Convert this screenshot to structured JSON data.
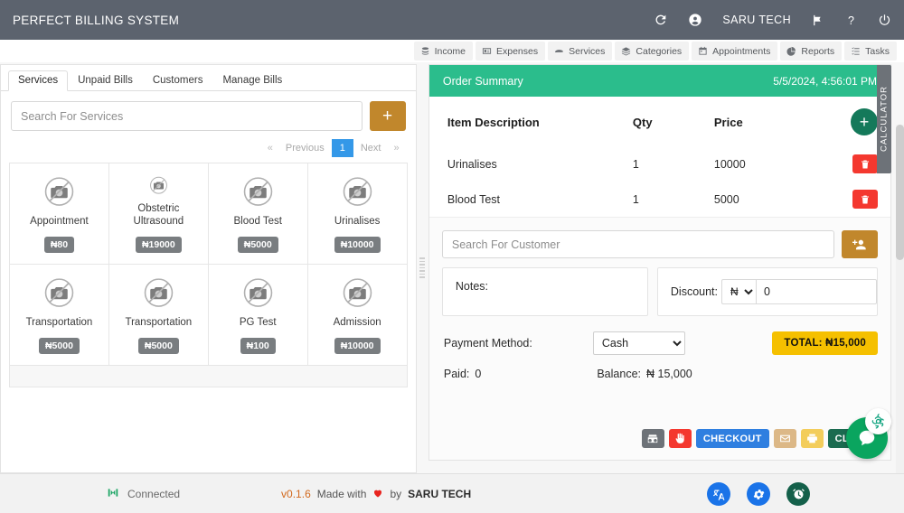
{
  "header": {
    "app_title": "PERFECT BILLING SYSTEM",
    "org_name": "SARU TECH",
    "icons": [
      "refresh-icon",
      "account-icon",
      "flag-icon",
      "help-icon",
      "power-icon"
    ]
  },
  "nav_tabs": [
    {
      "label": "Income",
      "icon": "coins-icon"
    },
    {
      "label": "Expenses",
      "icon": "receipt-icon"
    },
    {
      "label": "Services",
      "icon": "services-icon"
    },
    {
      "label": "Categories",
      "icon": "layers-icon"
    },
    {
      "label": "Appointments",
      "icon": "calendar-icon"
    },
    {
      "label": "Reports",
      "icon": "pie-chart-icon"
    },
    {
      "label": "Tasks",
      "icon": "list-icon"
    }
  ],
  "left_panel": {
    "tabs": [
      {
        "label": "Services",
        "active": true
      },
      {
        "label": "Unpaid Bills",
        "active": false
      },
      {
        "label": "Customers",
        "active": false
      },
      {
        "label": "Manage Bills",
        "active": false
      }
    ],
    "search": {
      "placeholder": "Search For Services",
      "value": ""
    },
    "add_button_label": "+",
    "pagination": {
      "first": "«",
      "previous": "Previous",
      "current_page": "1",
      "next": "Next",
      "last": "»"
    },
    "services": [
      {
        "name": "Appointment",
        "price": "₦80"
      },
      {
        "name": "Obstetric Ultrasound",
        "price": "₦19000"
      },
      {
        "name": "Blood Test",
        "price": "₦5000"
      },
      {
        "name": "Urinalises",
        "price": "₦10000"
      },
      {
        "name": "Transportation",
        "price": "₦5000"
      },
      {
        "name": "Transportation",
        "price": "₦5000"
      },
      {
        "name": "PG Test",
        "price": "₦100"
      },
      {
        "name": "Admission",
        "price": "₦10000"
      }
    ]
  },
  "order_summary": {
    "title": "Order Summary",
    "datetime": "5/5/2024, 4:56:01 PM",
    "columns": {
      "description": "Item Description",
      "qty": "Qty",
      "price": "Price"
    },
    "add_item_label": "+",
    "items": [
      {
        "description": "Urinalises",
        "qty": "1",
        "price": "10000"
      },
      {
        "description": "Blood Test",
        "qty": "1",
        "price": "5000"
      }
    ],
    "customer_search": {
      "placeholder": "Search For Customer",
      "value": ""
    },
    "notes_label": "Notes:",
    "discount": {
      "label": "Discount:",
      "currency": "₦",
      "value": "0"
    },
    "payment": {
      "label": "Payment Method:",
      "selected": "Cash"
    },
    "total_label": "TOTAL: ₦15,000",
    "paid_label": "Paid:",
    "paid_value": "0",
    "balance_label": "Balance:",
    "balance_value": "₦ 15,000",
    "actions": [
      {
        "name": "register",
        "label": ""
      },
      {
        "name": "hold",
        "label": ""
      },
      {
        "name": "checkout",
        "label": "CHECKOUT"
      },
      {
        "name": "email",
        "label": ""
      },
      {
        "name": "print",
        "label": ""
      },
      {
        "name": "clear",
        "label": "CLEAR"
      }
    ],
    "calculator_tab": "CALCULATOR"
  },
  "footer": {
    "connection_status": "Connected",
    "version": "v0.1.6",
    "made_with_prefix": "Made with",
    "made_with_suffix": "by",
    "brand": "SARU TECH",
    "icons": [
      "translate-icon",
      "settings-icon",
      "alarm-icon"
    ]
  },
  "colors": {
    "header_bg": "#5c636e",
    "order_header": "#2bbd8c",
    "accent_gold": "#c1872c",
    "total_yellow": "#f5c000",
    "checkout_blue": "#2f7fe0",
    "clear_green": "#1b6b50",
    "delete_red": "#f4382f",
    "page_blue": "#3498e8",
    "fab_green": "#0aa55f"
  }
}
